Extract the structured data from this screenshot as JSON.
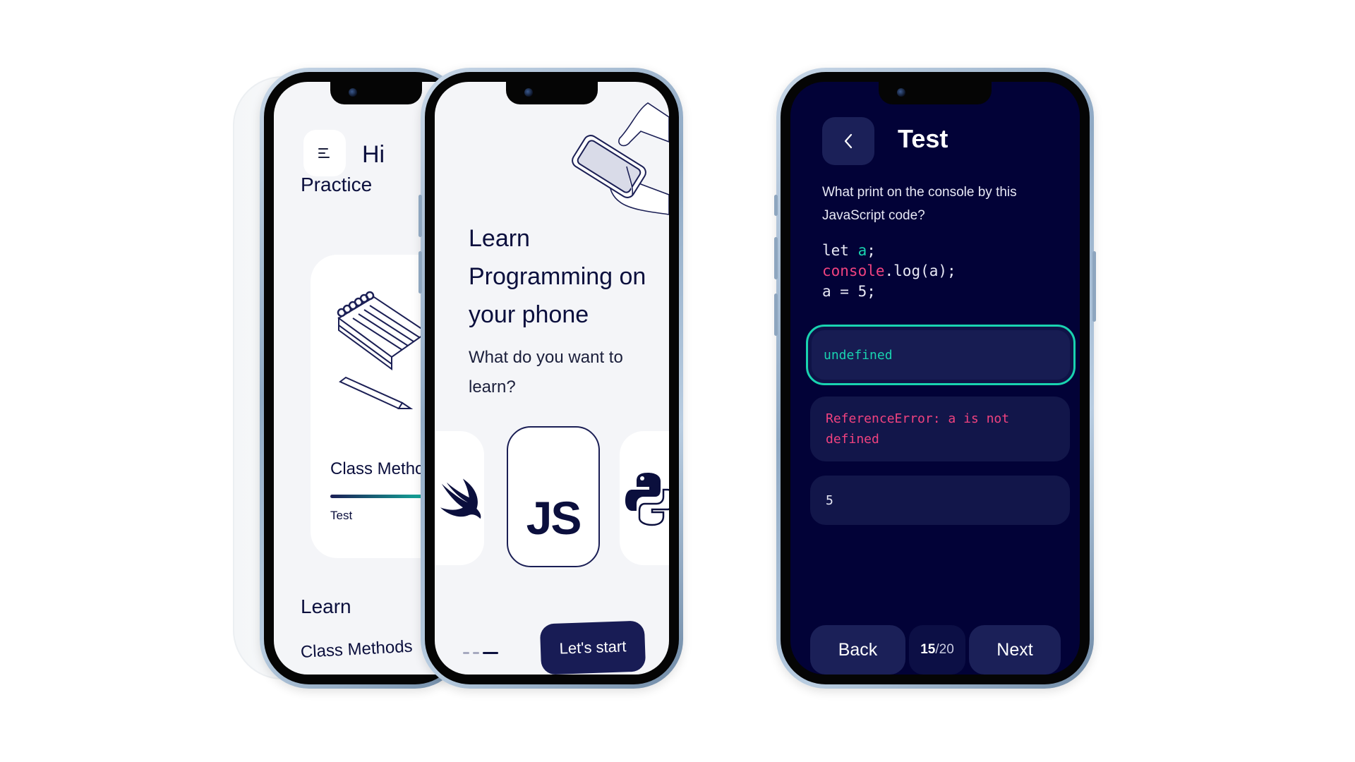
{
  "left_phone": {
    "greeting": "Hi",
    "menu_icon": "menu-icon",
    "practice_section_title": "Practice",
    "practice_card": {
      "illustration": "notebook-and-pencil-icon",
      "title": "Class Methods",
      "progress_fraction": 0.8,
      "subtitle": "Test"
    },
    "learn_section_title": "Learn",
    "learn_items": [
      "Class Methods"
    ]
  },
  "middle_phone": {
    "illustration": "hands-holding-phone-icon",
    "headline": "Learn Programming on your phone",
    "subheadline": "What do you want to learn?",
    "languages": [
      {
        "name": "Swift",
        "icon": "swift-icon",
        "selected": false
      },
      {
        "name": "JavaScript",
        "label": "JS",
        "icon": "javascript-icon",
        "selected": true
      },
      {
        "name": "Python",
        "icon": "python-icon",
        "selected": false
      }
    ],
    "page_indicator": {
      "total": 3,
      "active_index": 2
    },
    "cta_label": "Let's start"
  },
  "right_phone": {
    "back_icon": "chevron-left-icon",
    "title": "Test",
    "question": "What print on the console by this JavaScript code?",
    "code_lines": [
      {
        "parts": [
          {
            "text": "let ",
            "kind": "plain"
          },
          {
            "text": "a",
            "kind": "var"
          },
          {
            "text": ";",
            "kind": "plain"
          }
        ]
      },
      {
        "parts": [
          {
            "text": "console",
            "kind": "obj"
          },
          {
            "text": ".log(a);",
            "kind": "plain"
          }
        ]
      },
      {
        "parts": [
          {
            "text": "a = 5;",
            "kind": "plain"
          }
        ]
      }
    ],
    "answers": [
      {
        "text": "undefined",
        "state": "selected-correct"
      },
      {
        "text": "ReferenceError: a is not defined",
        "state": "error"
      },
      {
        "text": "5",
        "state": "default"
      }
    ],
    "back_label": "Back",
    "next_label": "Next",
    "counter": {
      "current": "15",
      "separator": "/",
      "total": "20"
    },
    "colors": {
      "background": "#020237",
      "card": "#12164a",
      "accent_correct": "#19d3b0",
      "accent_error": "#f0427f"
    }
  }
}
